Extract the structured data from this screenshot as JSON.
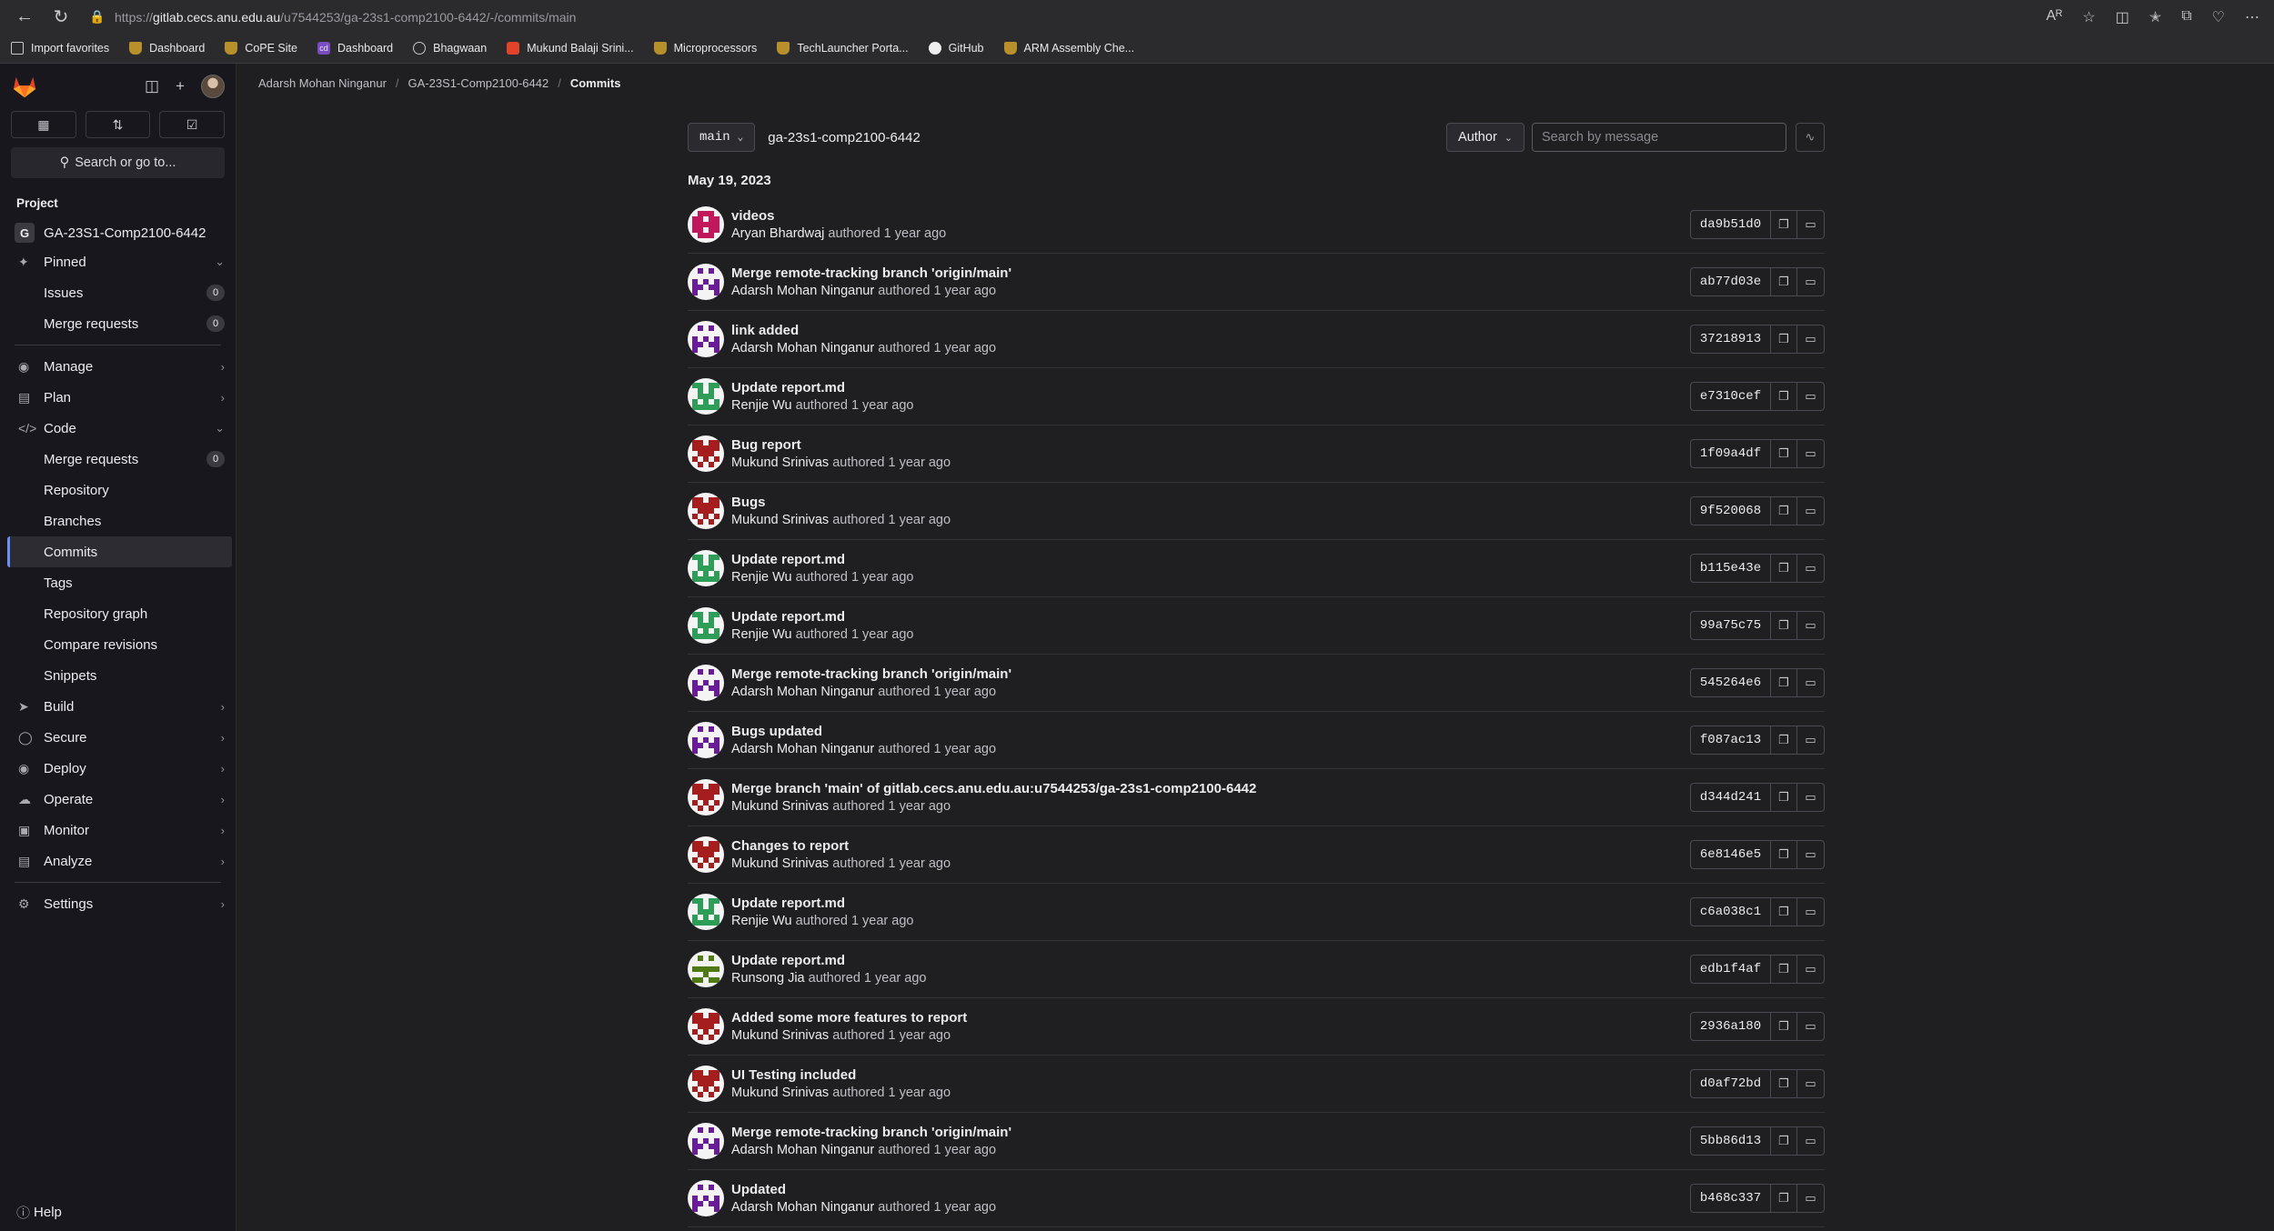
{
  "browser": {
    "url_scheme": "https://",
    "url_host": "gitlab.cecs.anu.edu.au",
    "url_path": "/u7544253/ga-23s1-comp2100-6442/-/commits/main",
    "bookmarks": [
      {
        "label": "Import favorites",
        "icon": "folder"
      },
      {
        "label": "Dashboard",
        "icon": "shield"
      },
      {
        "label": "CoPE Site",
        "icon": "shield"
      },
      {
        "label": "Dashboard",
        "icon": "purple"
      },
      {
        "label": "Bhagwaan",
        "icon": "circ"
      },
      {
        "label": "Mukund Balaji Srini...",
        "icon": "red"
      },
      {
        "label": "Microprocessors",
        "icon": "shield"
      },
      {
        "label": "TechLauncher Porta...",
        "icon": "shield"
      },
      {
        "label": "GitHub",
        "icon": "gh"
      },
      {
        "label": "ARM Assembly Che...",
        "icon": "shield"
      }
    ]
  },
  "sidebar": {
    "search_label": "Search or go to...",
    "section_title": "Project",
    "project_badge": "G",
    "project_name": "GA-23S1-Comp2100-6442",
    "pinned_label": "Pinned",
    "pinned_items": [
      {
        "label": "Issues",
        "count": "0"
      },
      {
        "label": "Merge requests",
        "count": "0"
      }
    ],
    "manage_label": "Manage",
    "plan_label": "Plan",
    "code_label": "Code",
    "code_items": {
      "merge_requests": "Merge requests",
      "merge_requests_count": "0",
      "repository": "Repository",
      "branches": "Branches",
      "commits": "Commits",
      "tags": "Tags",
      "repository_graph": "Repository graph",
      "compare_revisions": "Compare revisions",
      "snippets": "Snippets"
    },
    "build_label": "Build",
    "secure_label": "Secure",
    "deploy_label": "Deploy",
    "operate_label": "Operate",
    "monitor_label": "Monitor",
    "analyze_label": "Analyze",
    "settings_label": "Settings",
    "help_label": "Help"
  },
  "breadcrumb": {
    "user": "Adarsh Mohan Ninganur",
    "project": "GA-23S1-Comp2100-6442",
    "current": "Commits"
  },
  "toolbar": {
    "branch": "main",
    "repo_path": "ga-23s1-comp2100-6442",
    "author_label": "Author",
    "search_placeholder": "Search by message"
  },
  "date_header": "May 19, 2023",
  "authored_word": "authored",
  "time_ago": "1 year ago",
  "commits": [
    {
      "title": "videos",
      "author": "Aryan Bhardwaj",
      "sha": "da9b51d0",
      "avatar_color": "#c2185b"
    },
    {
      "title": "Merge remote-tracking branch 'origin/main'",
      "author": "Adarsh Mohan Ninganur",
      "sha": "ab77d03e",
      "avatar_color": "#6a1b9a"
    },
    {
      "title": "link added",
      "author": "Adarsh Mohan Ninganur",
      "sha": "37218913",
      "avatar_color": "#6a1b9a"
    },
    {
      "title": "Update report.md",
      "author": "Renjie Wu",
      "sha": "e7310cef",
      "avatar_color": "#2e9d57"
    },
    {
      "title": "Bug report",
      "author": "Mukund Srinivas",
      "sha": "1f09a4df",
      "avatar_color": "#a51d1d"
    },
    {
      "title": "Bugs",
      "author": "Mukund Srinivas",
      "sha": "9f520068",
      "avatar_color": "#a51d1d"
    },
    {
      "title": "Update report.md",
      "author": "Renjie Wu",
      "sha": "b115e43e",
      "avatar_color": "#2e9d57"
    },
    {
      "title": "Update report.md",
      "author": "Renjie Wu",
      "sha": "99a75c75",
      "avatar_color": "#2e9d57"
    },
    {
      "title": "Merge remote-tracking branch 'origin/main'",
      "author": "Adarsh Mohan Ninganur",
      "sha": "545264e6",
      "avatar_color": "#6a1b9a"
    },
    {
      "title": "Bugs updated",
      "author": "Adarsh Mohan Ninganur",
      "sha": "f087ac13",
      "avatar_color": "#6a1b9a"
    },
    {
      "title": "Merge branch 'main' of gitlab.cecs.anu.edu.au:u7544253/ga-23s1-comp2100-6442",
      "author": "Mukund Srinivas",
      "sha": "d344d241",
      "avatar_color": "#a51d1d"
    },
    {
      "title": "Changes to report",
      "author": "Mukund Srinivas",
      "sha": "6e8146e5",
      "avatar_color": "#a51d1d"
    },
    {
      "title": "Update report.md",
      "author": "Renjie Wu",
      "sha": "c6a038c1",
      "avatar_color": "#2e9d57"
    },
    {
      "title": "Update report.md",
      "author": "Runsong Jia",
      "sha": "edb1f4af",
      "avatar_color": "#4f7a12"
    },
    {
      "title": "Added some more features to report",
      "author": "Mukund Srinivas",
      "sha": "2936a180",
      "avatar_color": "#a51d1d"
    },
    {
      "title": "UI Testing included",
      "author": "Mukund Srinivas",
      "sha": "d0af72bd",
      "avatar_color": "#a51d1d"
    },
    {
      "title": "Merge remote-tracking branch 'origin/main'",
      "author": "Adarsh Mohan Ninganur",
      "sha": "5bb86d13",
      "avatar_color": "#6a1b9a"
    },
    {
      "title": "Updated",
      "author": "Adarsh Mohan Ninganur",
      "sha": "b468c337",
      "avatar_color": "#6a1b9a"
    }
  ]
}
